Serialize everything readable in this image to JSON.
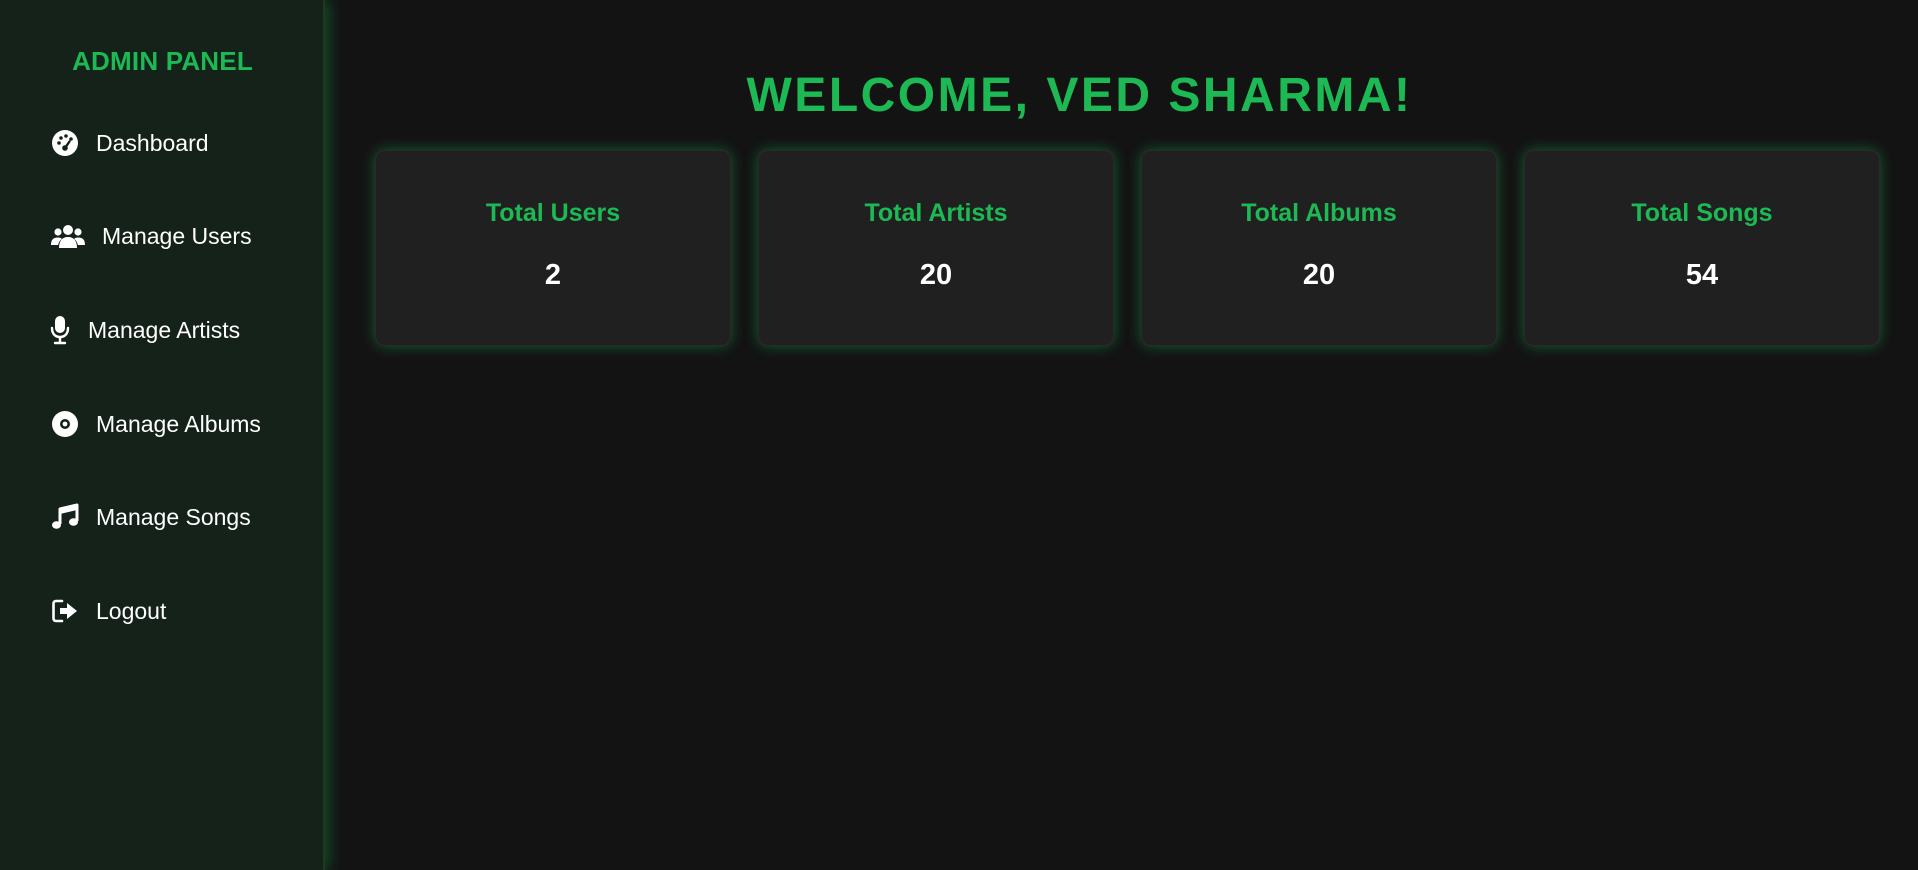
{
  "sidebar": {
    "title": "ADMIN PANEL",
    "items": [
      {
        "label": "Dashboard",
        "icon": "dashboard-gauge-icon"
      },
      {
        "label": "Manage Users",
        "icon": "users-icon"
      },
      {
        "label": "Manage Artists",
        "icon": "microphone-icon"
      },
      {
        "label": "Manage Albums",
        "icon": "album-disc-icon"
      },
      {
        "label": "Manage Songs",
        "icon": "music-note-icon"
      },
      {
        "label": "Logout",
        "icon": "logout-icon"
      }
    ]
  },
  "main": {
    "welcome": "WELCOME, VED SHARMA!",
    "stats": [
      {
        "label": "Total Users",
        "value": "2"
      },
      {
        "label": "Total Artists",
        "value": "20"
      },
      {
        "label": "Total Albums",
        "value": "20"
      },
      {
        "label": "Total Songs",
        "value": "54"
      }
    ]
  },
  "colors": {
    "accent": "#1db954",
    "background": "#131313",
    "sidebar_background": "#14221a",
    "card_background": "#202020",
    "text": "#ffffff"
  }
}
